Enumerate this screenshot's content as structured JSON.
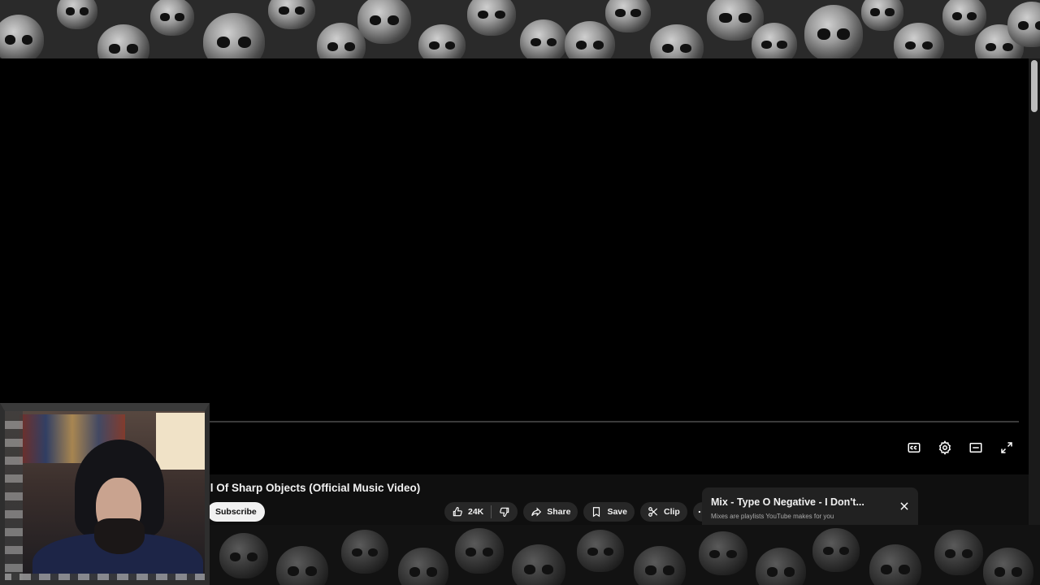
{
  "video": {
    "title": "ll Of Sharp Objects (Official Music Video)"
  },
  "player_controls": {
    "icons": [
      "closed-captions-icon",
      "settings-gear-icon",
      "theater-mode-icon",
      "fullscreen-icon"
    ]
  },
  "channel": {
    "subscribe_label": "Subscribe"
  },
  "actions": {
    "like_count": "24K",
    "share_label": "Share",
    "save_label": "Save",
    "clip_label": "Clip"
  },
  "mix": {
    "title": "Mix - Type O Negative - I Don't...",
    "subtitle": "Mixes are playlists YouTube makes for you"
  },
  "colors": {
    "page_background": "#0f0f0f",
    "pill_background": "#272727",
    "subscribe_background": "#f1f1f1",
    "mix_card_background": "#212121"
  }
}
